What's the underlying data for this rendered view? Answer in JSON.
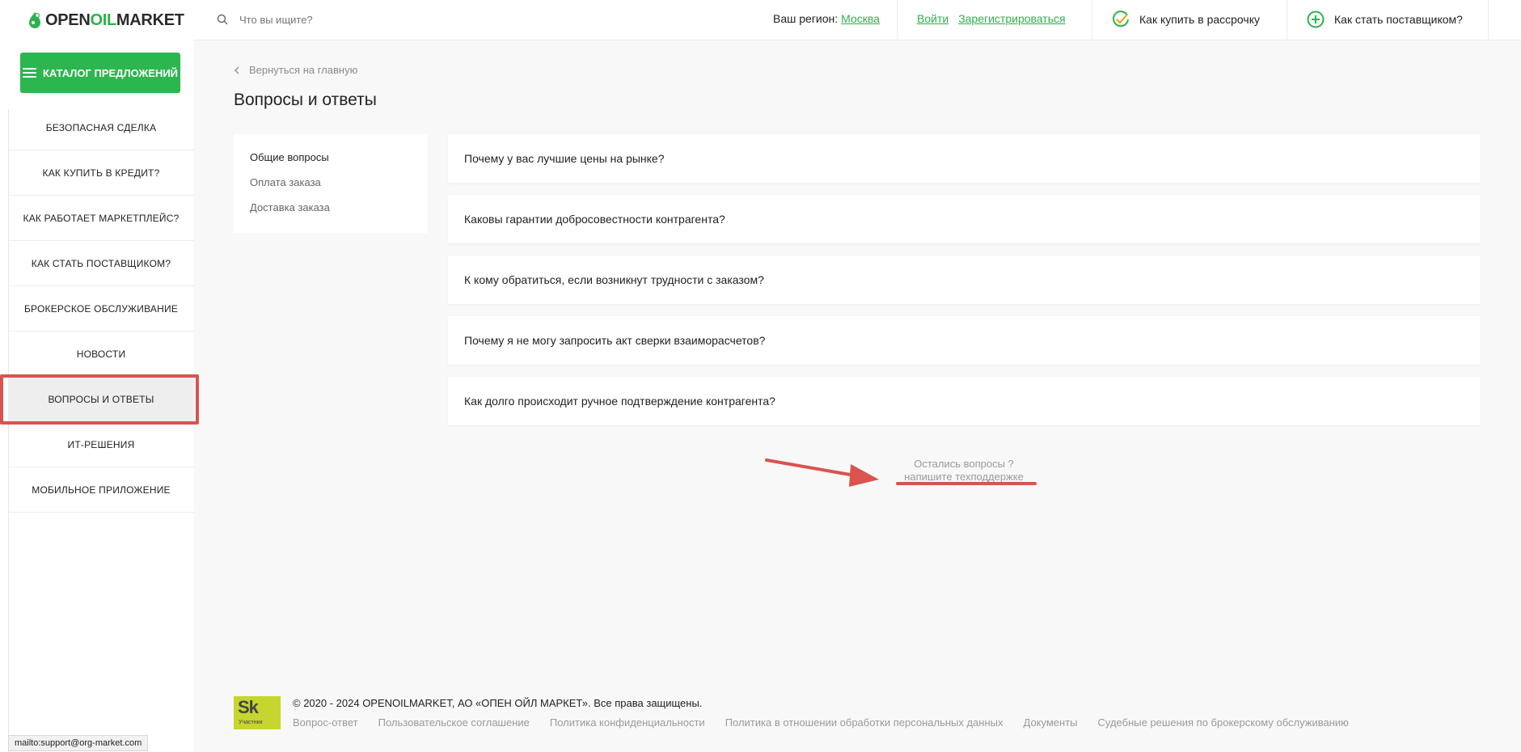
{
  "logo": {
    "part1": "OPEN",
    "part2": "OIL",
    "part3": "MARKET"
  },
  "sidebar": {
    "catalog_label": "КАТАЛОГ ПРЕДЛОЖЕНИЙ",
    "items": [
      {
        "label": "БЕЗОПАСНАЯ СДЕЛКА"
      },
      {
        "label": "КАК КУПИТЬ В КРЕДИТ?"
      },
      {
        "label": "КАК РАБОТАЕТ МАРКЕТПЛЕЙС?"
      },
      {
        "label": "КАК СТАТЬ ПОСТАВЩИКОМ?"
      },
      {
        "label": "БРОКЕРСКОЕ ОБСЛУЖИВАНИЕ"
      },
      {
        "label": "НОВОСТИ"
      },
      {
        "label": "ВОПРОСЫ И ОТВЕТЫ"
      },
      {
        "label": "ИТ-РЕШЕНИЯ"
      },
      {
        "label": "МОБИЛЬНОЕ ПРИЛОЖЕНИЕ"
      }
    ]
  },
  "header": {
    "search_placeholder": "Что вы ищите?",
    "region_label": "Ваш регион:",
    "region_value": "Москва",
    "login": "Войти",
    "register": "Зарегистрироваться",
    "installment": "Как купить в рассрочку",
    "supplier": "Как стать поставщиком?"
  },
  "main": {
    "back": "Вернуться на главную",
    "title": "Вопросы и ответы",
    "categories": [
      "Общие вопросы",
      "Оплата заказа",
      "Доставка заказа"
    ],
    "questions": [
      "Почему у вас лучшие цены на рынке?",
      "Каковы гарантии добросовестности контрагента?",
      "К кому обратиться, если возникнут трудности с заказом?",
      "Почему я не могу запросить акт сверки взаиморасчетов?",
      "Как долго происходит ручное подтверждение контрагента?"
    ],
    "support_line1": "Остались вопросы ?",
    "support_line2": "напишите техподдержке"
  },
  "footer": {
    "badge_title": "Sk",
    "badge_sub": "Участник",
    "copyright": "© 2020 - 2024 OPENOILMARKET, АО «ОПЕН ОЙЛ МАРКЕТ». Все права защищены.",
    "links": [
      "Вопрос-ответ",
      "Пользовательское соглашение",
      "Политика конфиденциальности",
      "Политика в отношении обработки персональных данных",
      "Документы",
      "Судебные решения по брокерскому обслуживанию"
    ]
  },
  "status_bar": "mailto:support@org-market.com",
  "colors": {
    "brand_green": "#2cb64f",
    "annotation_red": "#d9534f"
  }
}
